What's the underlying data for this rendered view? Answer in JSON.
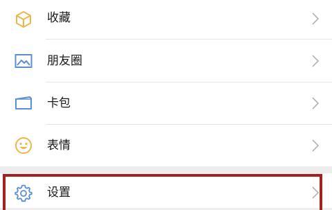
{
  "menu": {
    "items": [
      {
        "label": "收藏",
        "icon": "cube-icon"
      },
      {
        "label": "朋友圈",
        "icon": "image-icon"
      },
      {
        "label": "卡包",
        "icon": "card-icon"
      },
      {
        "label": "表情",
        "icon": "smile-icon"
      }
    ],
    "settings": {
      "label": "设置",
      "icon": "gear-icon"
    }
  },
  "colors": {
    "background": "#ededed",
    "row": "#ffffff",
    "icon_yellow": "#f2b34a",
    "icon_blue": "#5b8fd4",
    "highlight": "#a8201d"
  }
}
